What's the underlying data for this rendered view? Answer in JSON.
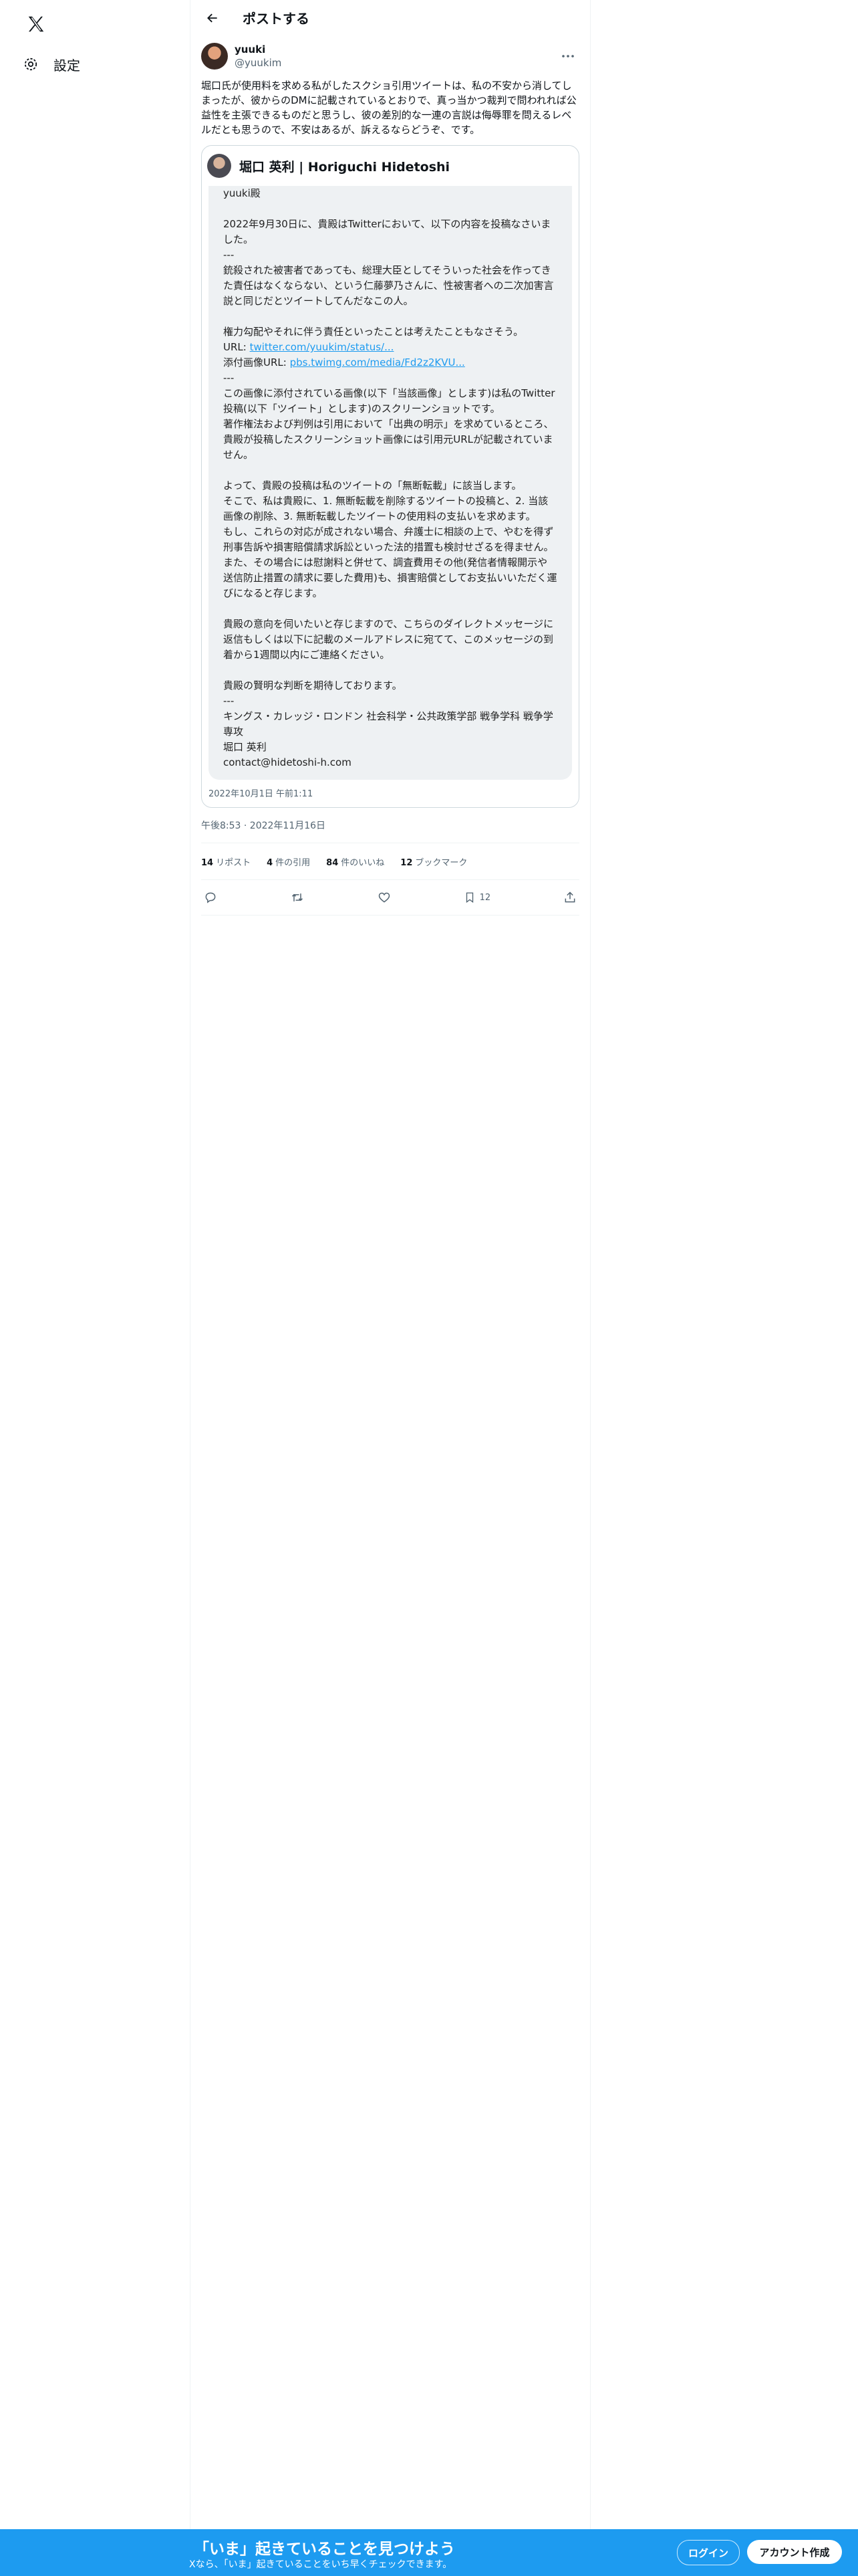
{
  "nav": {
    "logo": "x-logo",
    "settings_label": "設定"
  },
  "header": {
    "title": "ポストする"
  },
  "post": {
    "author_name": "yuuki",
    "author_handle": "@yuukim",
    "text": "堀口氏が使用料を求める私がしたスクショ引用ツイートは、私の不安から消してしまったが、彼からのDMに記載されているとおりで、真っ当かつ裁判で問われれば公益性を主張できるものだと思うし、彼の差別的な一連の言説は侮辱罪を問えるレベルだとも思うので、不安はあるが、訴えるならどうぞ、です。",
    "timestamp": "午後8:53 · 2022年11月16日"
  },
  "quote": {
    "author_name": "堀口 英利 | Horiguchi Hidetoshi",
    "date": "2022年10月1日 午前1:11",
    "salutation": "yuuki殿",
    "p1": "2022年9月30日に、貴殿はTwitterにおいて、以下の内容を投稿なさいました。\n---",
    "p2": "銃殺された被害者であっても、総理大臣としてそういった社会を作ってきた責任はなくならない、という仁藤夢乃さんに、性被害者への二次加害言説と同じだとツイートしてんだなこの人。\n\n権力勾配やそれに伴う責任といったことは考えたこともなさそう。",
    "url_label": "URL: ",
    "url": "twitter.com/yuukim/status/...",
    "img_label": "添付画像URL: ",
    "img_url": "pbs.twimg.com/media/Fd2z2KVU...",
    "p3": "---\nこの画像に添付されている画像(以下「当該画像」とします)は私のTwitter投稿(以下「ツイート」とします)のスクリーンショットです。\n著作権法および判例は引用において「出典の明示」を求めているところ、貴殿が投稿したスクリーンショット画像には引用元URLが記載されていません。\n\nよって、貴殿の投稿は私のツイートの「無断転載」に該当します。\nそこで、私は貴殿に、1. 無断転載を削除するツイートの投稿と、2. 当該画像の削除、3. 無断転載したツイートの使用料の支払いを求めます。\nもし、これらの対応が成されない場合、弁護士に相談の上で、やむを得ず刑事告訴や損害賠償請求訴訟といった法的措置も検討せざるを得ません。また、その場合には慰謝料と併せて、調査費用その他(発信者情報開示や送信防止措置の請求に要した費用)も、損害賠償としてお支払いいただく運びになると存じます。\n\n貴殿の意向を伺いたいと存じますので、こちらのダイレクトメッセージに返信もしくは以下に記載のメールアドレスに宛てて、このメッセージの到着から1週間以内にご連絡ください。\n\n貴殿の賢明な判断を期待しております。\n---\nキングス・カレッジ・ロンドン 社会科学・公共政策学部 戦争学科 戦争学専攻\n堀口 英利\ncontact@hidetoshi-h.com"
  },
  "stats": {
    "reposts_count": "14",
    "reposts_label": "リポスト",
    "quotes_count": "4",
    "quotes_label": "件の引用",
    "likes_count": "84",
    "likes_label": "件のいいね",
    "bookmarks_count": "12",
    "bookmarks_label": "ブックマーク"
  },
  "actions": {
    "bookmark_count": "12"
  },
  "bottom_bar": {
    "title": "「いま」起きていることを見つけよう",
    "subtitle": "Xなら、「いま」起きていることをいち早くチェックできます。",
    "login_label": "ログイン",
    "signup_label": "アカウント作成"
  },
  "colors": {
    "accent": "#1d9bf0",
    "text": "#0f1419",
    "muted": "#536471"
  }
}
